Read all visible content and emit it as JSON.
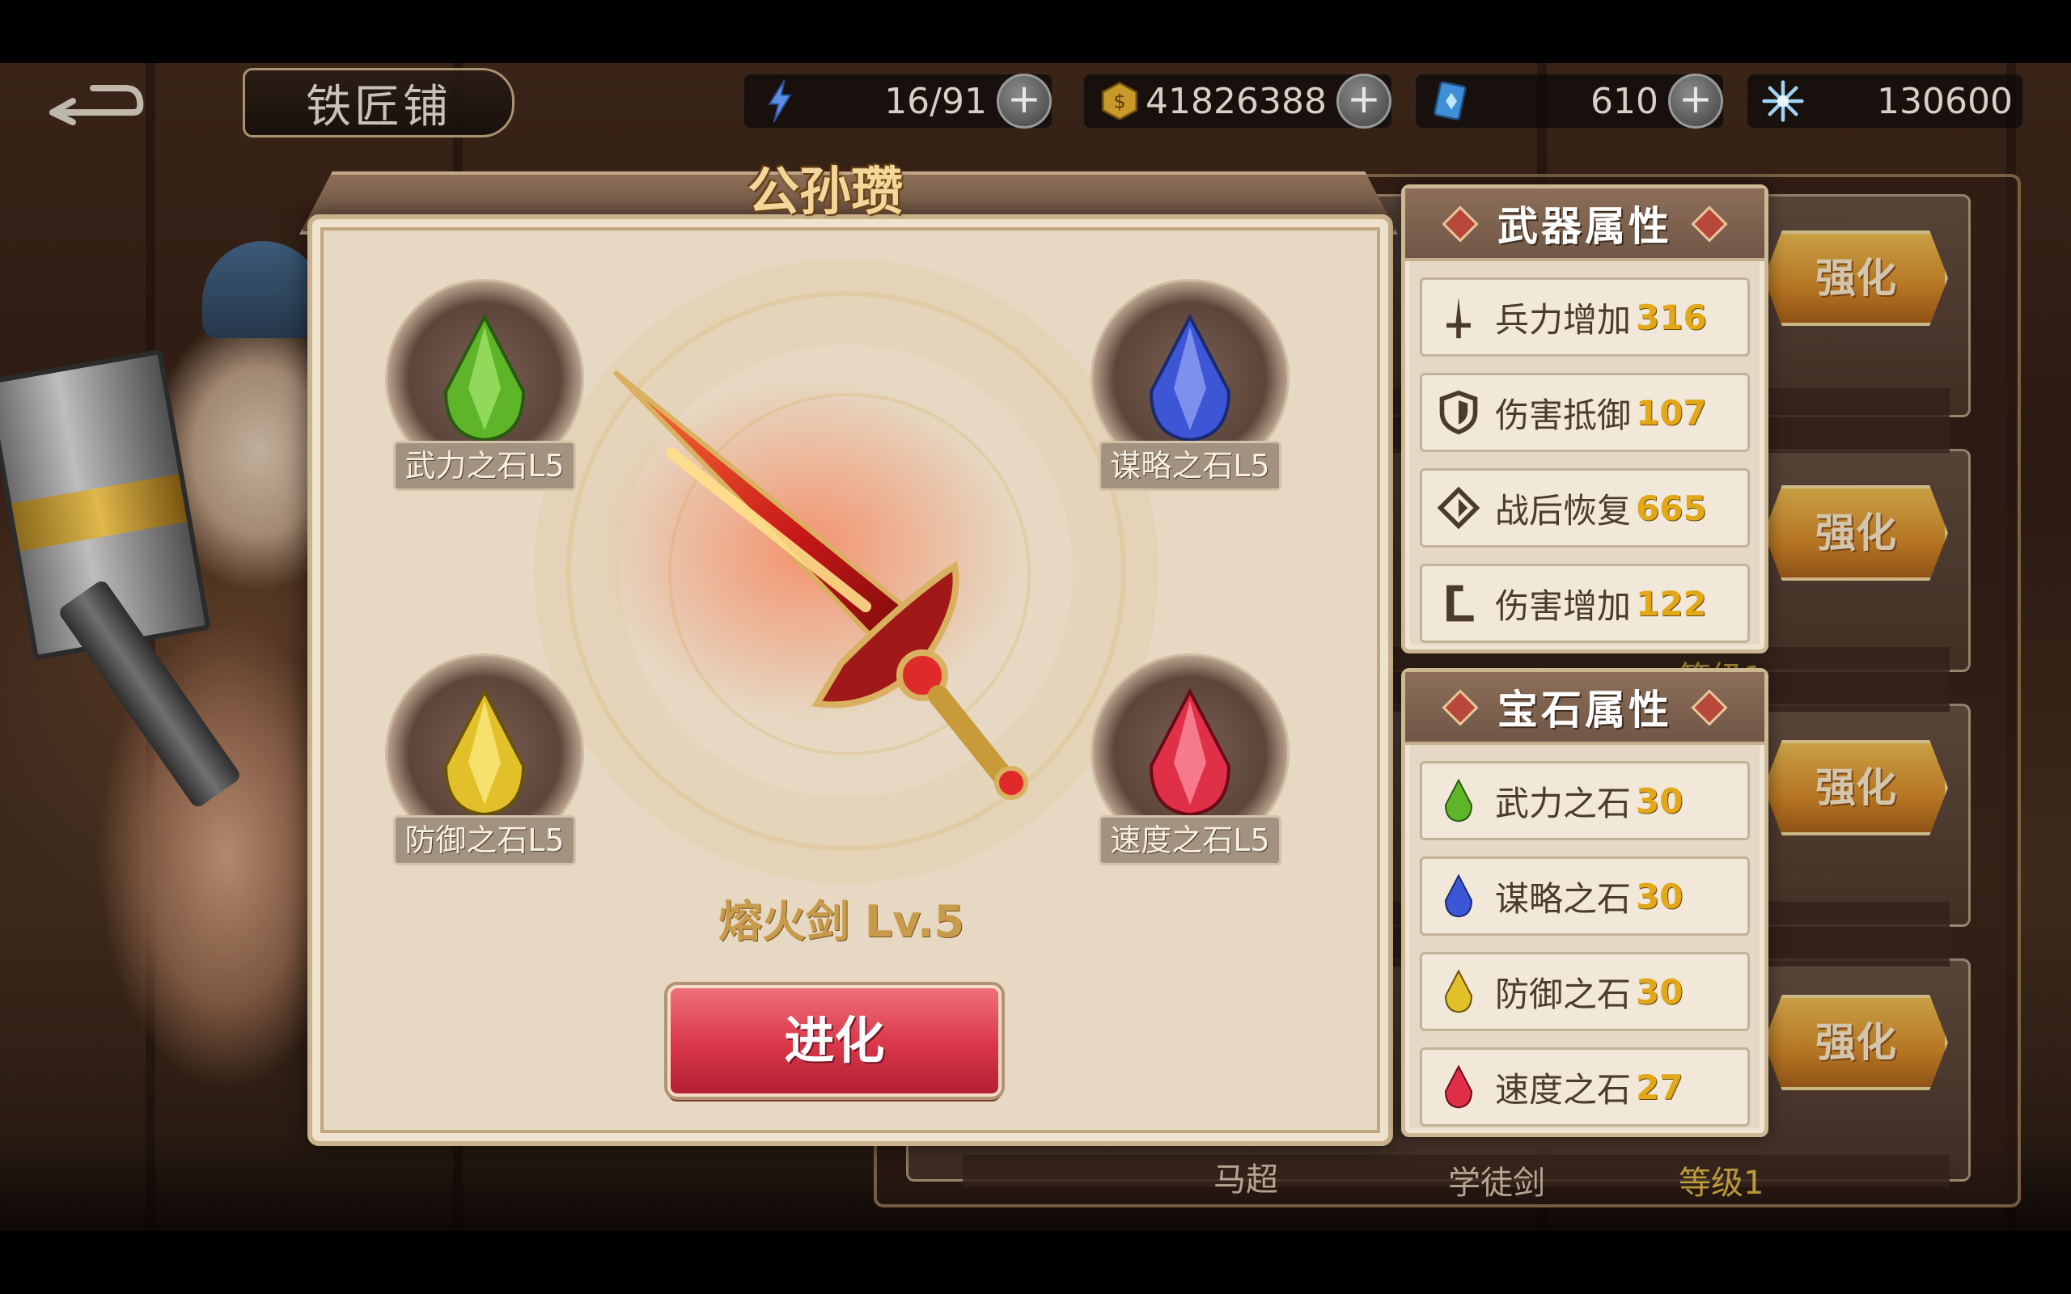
{
  "header": {
    "title": "铁匠铺"
  },
  "resources": [
    {
      "id": "stamina",
      "icon": "lightning-icon",
      "value": "16/91"
    },
    {
      "id": "gold",
      "icon": "coin-icon",
      "value": "41826388"
    },
    {
      "id": "gems",
      "icon": "crystal-card-icon",
      "value": "610"
    },
    {
      "id": "stars",
      "icon": "snowflake-star-icon",
      "value": "130600"
    }
  ],
  "panel": {
    "hero_name": "公孙瓒",
    "weapon_name": "熔火剑 Lv.5",
    "evolve_label": "进化",
    "gems": [
      {
        "label": "武力之石L5",
        "color": "#5fb52a"
      },
      {
        "label": "谋略之石L5",
        "color": "#3c56d6"
      },
      {
        "label": "防御之石L5",
        "color": "#e2c02a"
      },
      {
        "label": "速度之石L5",
        "color": "#e03048"
      }
    ]
  },
  "weapon_attributes": {
    "title": "武器属性",
    "items": [
      {
        "label": "兵力增加",
        "value": "316"
      },
      {
        "label": "伤害抵御",
        "value": "107"
      },
      {
        "label": "战后恢复",
        "value": "665"
      },
      {
        "label": "伤害增加",
        "value": "122"
      }
    ]
  },
  "gem_attributes": {
    "title": "宝石属性",
    "items": [
      {
        "label": "武力之石",
        "value": "30"
      },
      {
        "label": "谋略之石",
        "value": "30"
      },
      {
        "label": "防御之石",
        "value": "30"
      },
      {
        "label": "速度之石",
        "value": "27"
      }
    ]
  },
  "background_list": {
    "strengthen_label": "强化",
    "last_row": {
      "hero": "马超",
      "weapon": "学徒剑",
      "level": "等级1"
    },
    "partial_level": "等级1"
  },
  "colors": {
    "accent_gold": "#e2a818",
    "evolve_red": "#d83648",
    "panel_bg": "#e6d8c2"
  }
}
